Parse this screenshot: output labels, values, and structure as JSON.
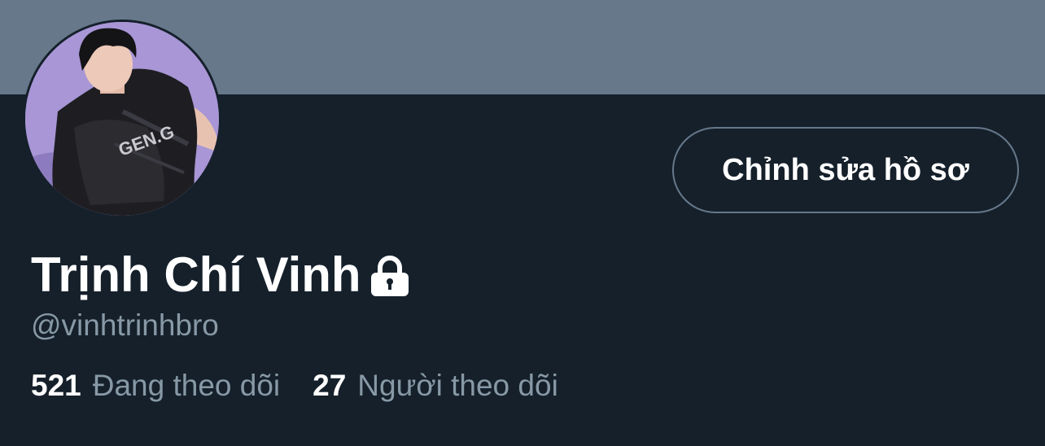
{
  "profile": {
    "display_name": "Trịnh Chí Vinh",
    "handle": "@vinhtrinhbro",
    "protected_icon": "lock-icon",
    "avatar_icon": "profile-photo",
    "edit_button_label": "Chỉnh sửa hồ sơ"
  },
  "stats": {
    "following_count": "521",
    "following_label": "Đang theo dõi",
    "followers_count": "27",
    "followers_label": "Người theo dõi"
  },
  "colors": {
    "background": "#15202b",
    "banner": "#66788a",
    "primary_text": "#ffffff",
    "secondary_text": "#8899a6",
    "button_border": "#66788a"
  }
}
